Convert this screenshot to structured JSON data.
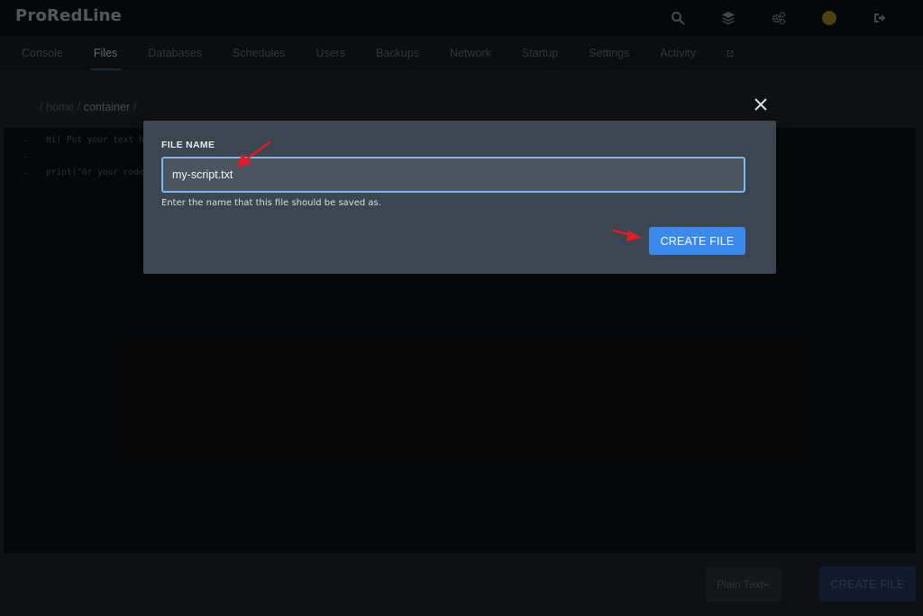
{
  "app": {
    "brand": "ProRedLine"
  },
  "header_icons": [
    "search-icon",
    "layers-icon",
    "cogs-icon",
    "avatar",
    "logout-icon"
  ],
  "tabs": [
    {
      "label": "Console"
    },
    {
      "label": "Files"
    },
    {
      "label": "Databases"
    },
    {
      "label": "Schedules"
    },
    {
      "label": "Users"
    },
    {
      "label": "Backups"
    },
    {
      "label": "Network"
    },
    {
      "label": "Startup"
    },
    {
      "label": "Settings"
    },
    {
      "label": "Activity"
    }
  ],
  "active_tab": "Files",
  "breadcrumb": {
    "home": "home",
    "sep": "/",
    "current": "container"
  },
  "editor": {
    "lines": [
      "Hi! Put your text h",
      "print(\"Or your code"
    ]
  },
  "bottom": {
    "language": "Plain Text",
    "create_label": "CREATE FILE"
  },
  "modal": {
    "label": "FILE NAME",
    "value": "my-script.txt",
    "help": "Enter the name that this file should be saved as.",
    "create_label": "CREATE FILE"
  },
  "colors": {
    "accent": "#3b89ed",
    "annotation": "#e81b23"
  }
}
